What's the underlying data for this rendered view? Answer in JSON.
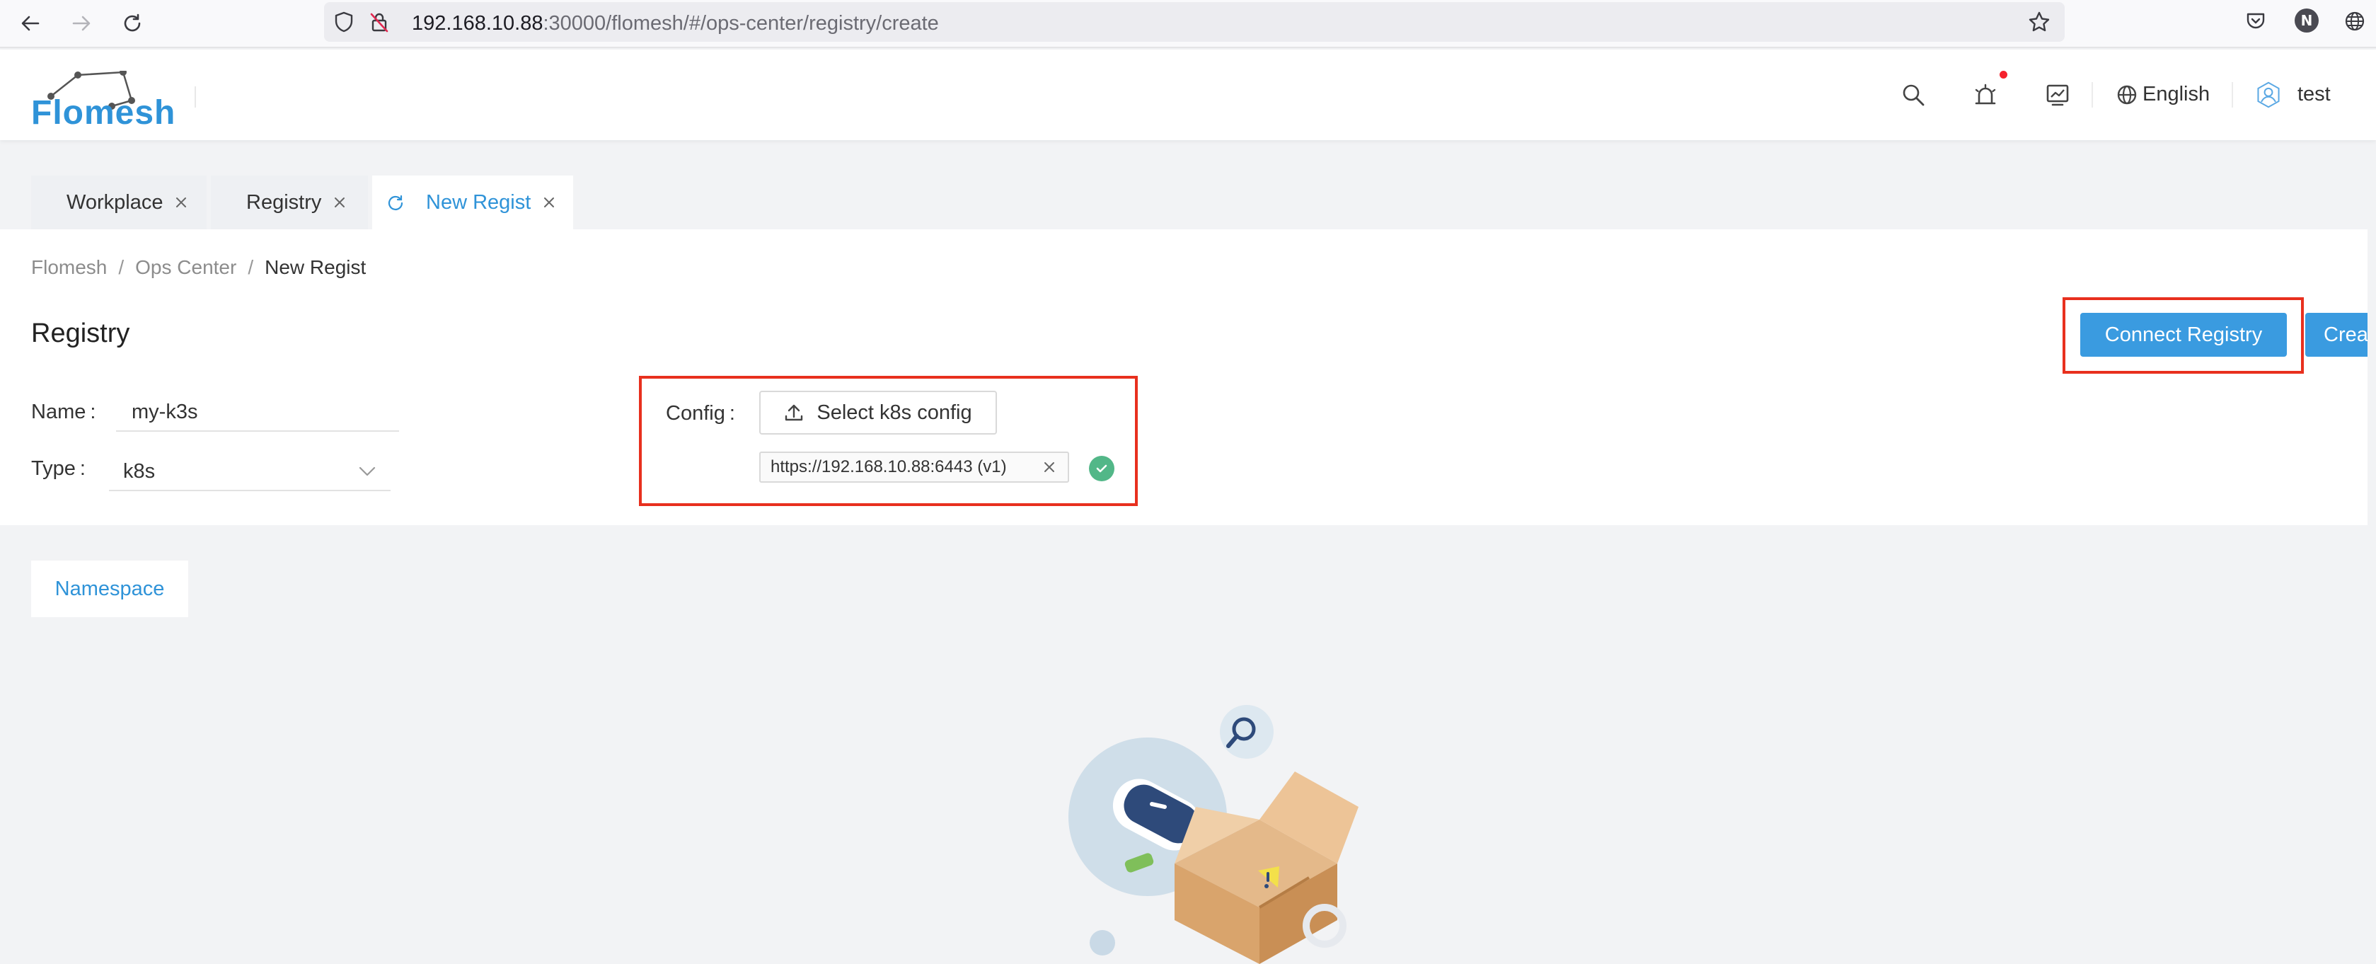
{
  "browser": {
    "url_host": "192.168.10.88",
    "url_rest": ":30000/flomesh/#/ops-center/registry/create",
    "profile_initial": "N"
  },
  "header": {
    "logo_text": "Flomesh",
    "language": "English",
    "user": "test"
  },
  "tabs": [
    {
      "label": "Workplace"
    },
    {
      "label": "Registry"
    },
    {
      "label": "New Regist"
    }
  ],
  "breadcrumb": {
    "items": [
      "Flomesh",
      "Ops Center",
      "New Regist"
    ],
    "separator": "/"
  },
  "page": {
    "title": "Registry"
  },
  "form": {
    "name_label": "Name",
    "name_value": "my-k3s",
    "type_label": "Type",
    "type_value": "k8s",
    "config_label": "Config",
    "select_config_label": "Select k8s config",
    "config_file": "https://192.168.10.88:6443 (v1)",
    "colon": ":"
  },
  "actions": {
    "connect_label": "Connect Registry",
    "create_label": "Create"
  },
  "sub_tabs": {
    "namespace_label": "Namespace"
  },
  "colors": {
    "accent": "#2f93d8",
    "primary_button": "#3a9be0",
    "annotation": "#e8301e",
    "success": "#52b788"
  }
}
